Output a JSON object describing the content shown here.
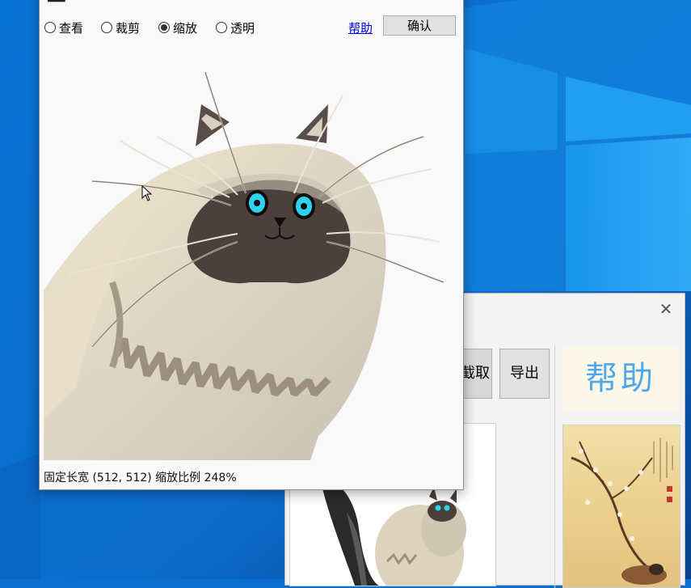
{
  "main_window": {
    "toolbar": {
      "radios": [
        {
          "label": "查看",
          "checked": false
        },
        {
          "label": "裁剪",
          "checked": false
        },
        {
          "label": "缩放",
          "checked": true
        },
        {
          "label": "透明",
          "checked": false
        }
      ],
      "help_link": "帮助",
      "confirm_label": "确认"
    },
    "status": "固定长宽 (512, 512) 缩放比例 248%"
  },
  "back_window": {
    "close_glyph": "✕",
    "capture_label": "截取",
    "export_label": "导出",
    "help_card_text": "帮助"
  },
  "colors": {
    "desktop": "#0a6fd0",
    "link": "#0000ee",
    "cat_eye": "#2fd3f0"
  }
}
